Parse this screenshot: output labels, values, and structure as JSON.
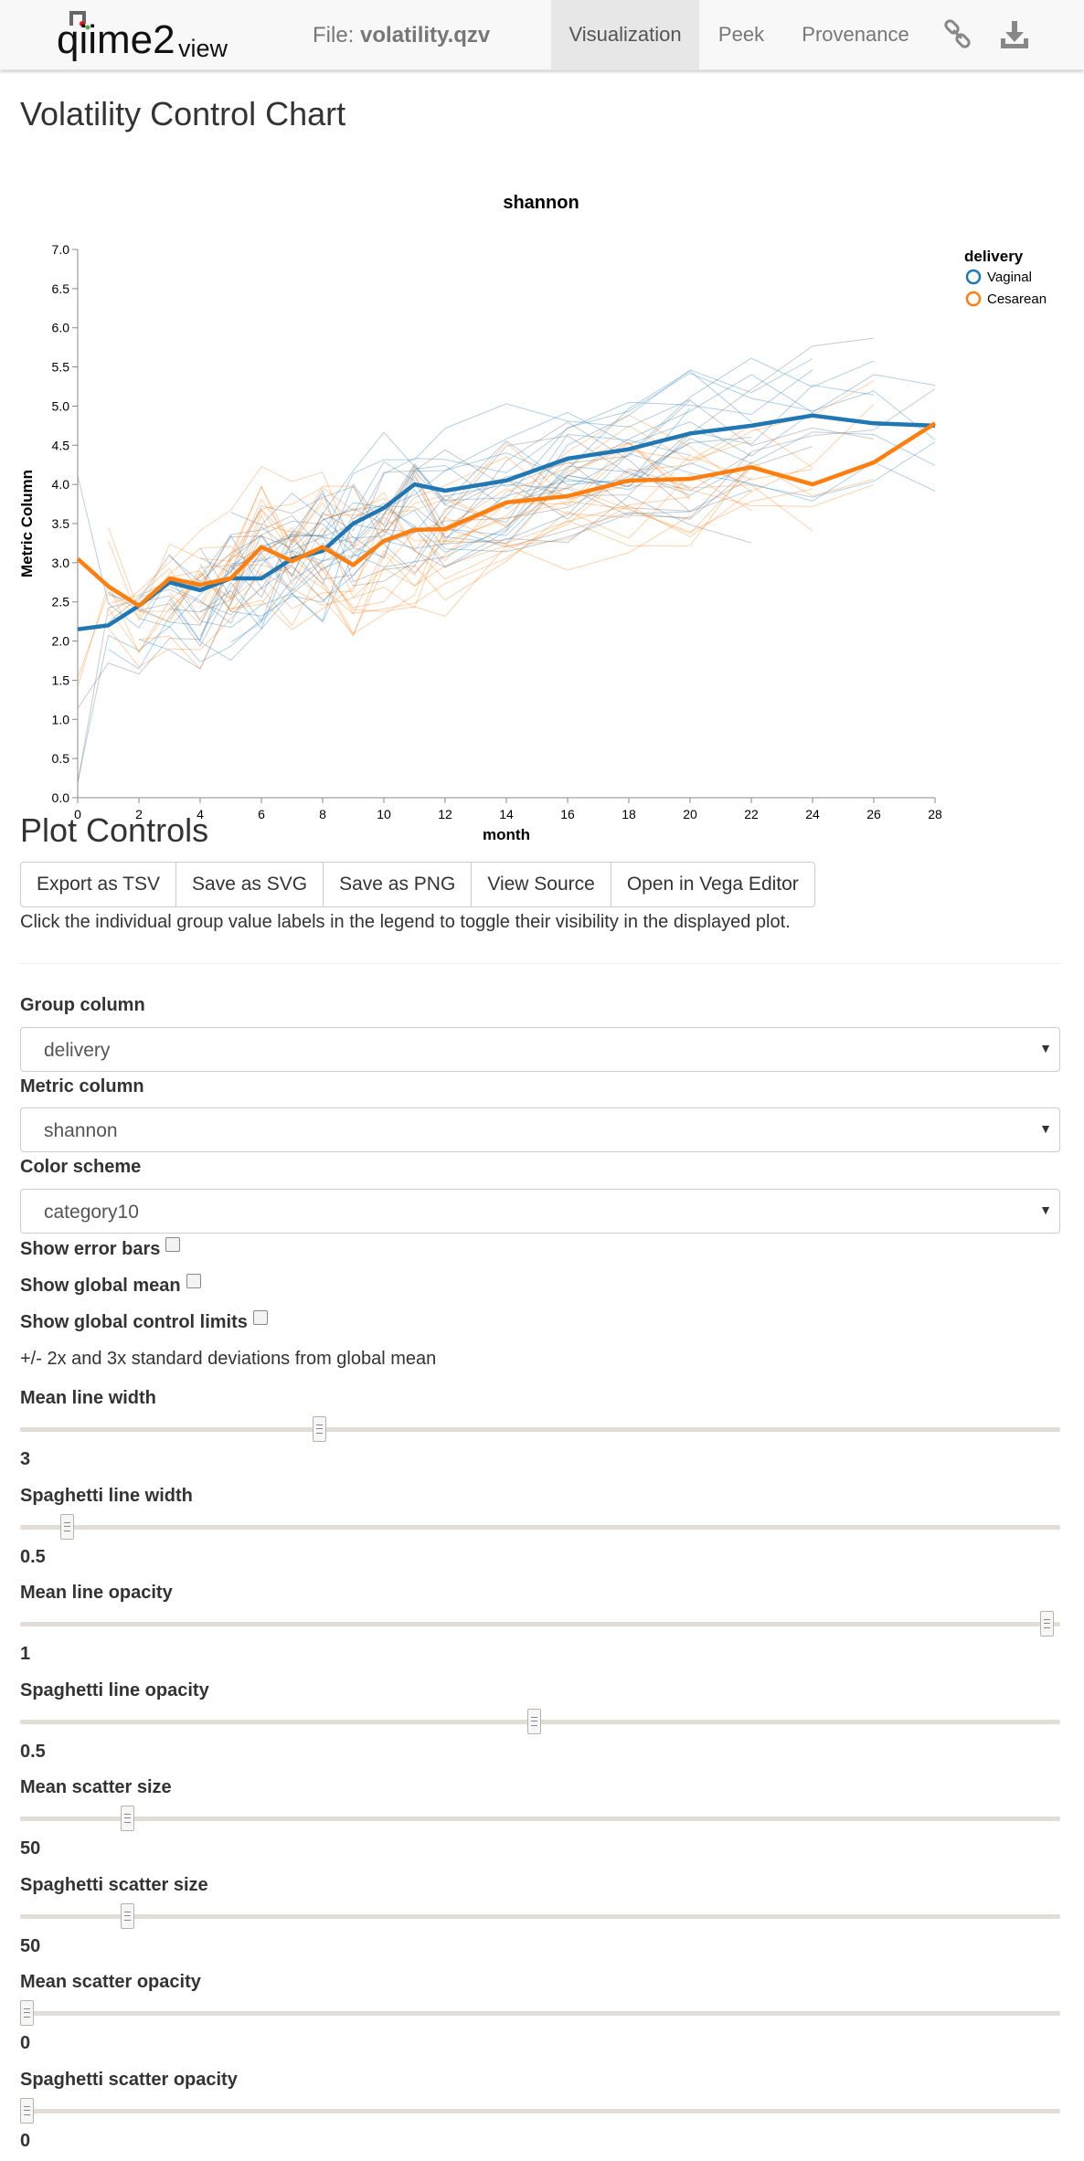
{
  "navbar": {
    "logo_text": "qiime2view",
    "file_prefix": "File:",
    "file_name": "volatility.qzv",
    "tabs": [
      {
        "label": "Visualization",
        "active": true
      },
      {
        "label": "Peek",
        "active": false
      },
      {
        "label": "Provenance",
        "active": false
      }
    ],
    "icons": [
      "link-icon",
      "download-icon"
    ]
  },
  "page_title": "Volatility Control Chart",
  "chart_data": {
    "type": "line",
    "title": "shannon",
    "xlabel": "month",
    "ylabel": "Metric Column",
    "xlim": [
      0,
      28
    ],
    "ylim": [
      0,
      7
    ],
    "xticks": [
      0,
      2,
      4,
      6,
      8,
      10,
      12,
      14,
      16,
      18,
      20,
      22,
      24,
      26,
      28
    ],
    "yticks": [
      0,
      0.5,
      1.0,
      1.5,
      2.0,
      2.5,
      3.0,
      3.5,
      4.0,
      4.5,
      5.0,
      5.5,
      6.0,
      6.5,
      7.0
    ],
    "legend_title": "delivery",
    "legend_position": "top-right",
    "grid": false,
    "series": [
      {
        "name": "Vaginal",
        "color": "#1f77b4",
        "x": [
          0,
          1,
          2,
          3,
          4,
          5,
          6,
          7,
          8,
          9,
          10,
          11,
          12,
          14,
          16,
          18,
          20,
          22,
          24,
          26,
          28
        ],
        "values": [
          2.15,
          2.2,
          2.45,
          2.75,
          2.65,
          2.8,
          2.8,
          3.05,
          3.15,
          3.5,
          3.7,
          4.0,
          3.92,
          4.05,
          4.33,
          4.45,
          4.65,
          4.75,
          4.88,
          4.78,
          4.75
        ]
      },
      {
        "name": "Cesarean",
        "color": "#ff7f0e",
        "x": [
          0,
          1,
          2,
          3,
          4,
          5,
          6,
          7,
          8,
          9,
          10,
          11,
          12,
          14,
          16,
          18,
          20,
          22,
          24,
          26,
          28
        ],
        "values": [
          3.05,
          2.7,
          2.45,
          2.8,
          2.72,
          2.8,
          3.2,
          3.02,
          3.2,
          2.97,
          3.28,
          3.42,
          3.43,
          3.77,
          3.85,
          4.05,
          4.07,
          4.22,
          4.0,
          4.28,
          4.78
        ]
      }
    ]
  },
  "controls": {
    "title": "Plot Controls",
    "buttons": [
      "Export as TSV",
      "Save as SVG",
      "Save as PNG",
      "View Source",
      "Open in Vega Editor"
    ],
    "help_text": "Click the individual group value labels in the legend to toggle their visibility in the displayed plot.",
    "group_column": {
      "label": "Group column",
      "value": "delivery"
    },
    "metric_column": {
      "label": "Metric column",
      "value": "shannon"
    },
    "color_scheme": {
      "label": "Color scheme",
      "value": "category10"
    },
    "checkboxes": [
      {
        "label": "Show error bars",
        "checked": false
      },
      {
        "label": "Show global mean",
        "checked": false
      },
      {
        "label": "Show global control limits",
        "checked": false
      }
    ],
    "limits_note": "+/- 2x and 3x standard deviations from global mean",
    "sliders": [
      {
        "label": "Mean line width",
        "value": "3",
        "position": 0.287
      },
      {
        "label": "Spaghetti line width",
        "value": "0.5",
        "position": 0.045
      },
      {
        "label": "Mean line opacity",
        "value": "1",
        "position": 0.987
      },
      {
        "label": "Spaghetti line opacity",
        "value": "0.5",
        "position": 0.494
      },
      {
        "label": "Mean scatter size",
        "value": "50",
        "position": 0.103
      },
      {
        "label": "Spaghetti scatter size",
        "value": "50",
        "position": 0.103
      },
      {
        "label": "Mean scatter opacity",
        "value": "0",
        "position": 0.006
      },
      {
        "label": "Spaghetti scatter opacity",
        "value": "0",
        "position": 0.006
      }
    ]
  }
}
